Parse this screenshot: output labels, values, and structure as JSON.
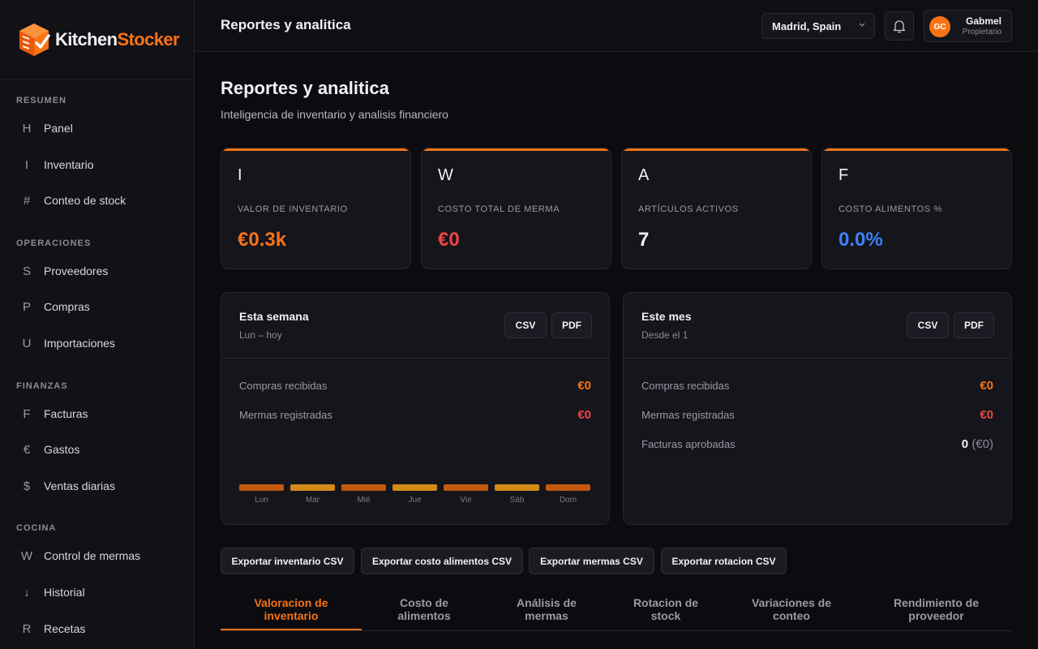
{
  "brand": {
    "name_a": "Kitchen",
    "name_b": "Stocker"
  },
  "sidebar": {
    "sections": [
      {
        "title": "RESUMEN",
        "items": [
          {
            "glyph": "H",
            "label": "Panel"
          },
          {
            "glyph": "I",
            "label": "Inventario"
          },
          {
            "glyph": "#",
            "label": "Conteo de stock"
          }
        ]
      },
      {
        "title": "OPERACIONES",
        "items": [
          {
            "glyph": "S",
            "label": "Proveedores"
          },
          {
            "glyph": "P",
            "label": "Compras"
          },
          {
            "glyph": "U",
            "label": "Importaciones"
          }
        ]
      },
      {
        "title": "FINANZAS",
        "items": [
          {
            "glyph": "F",
            "label": "Facturas"
          },
          {
            "glyph": "€",
            "label": "Gastos"
          },
          {
            "glyph": "$",
            "label": "Ventas diarias"
          }
        ]
      },
      {
        "title": "COCINA",
        "items": [
          {
            "glyph": "W",
            "label": "Control de mermas"
          },
          {
            "glyph": "↓",
            "label": "Historial"
          },
          {
            "glyph": "R",
            "label": "Recetas"
          }
        ]
      }
    ]
  },
  "topbar": {
    "title": "Reportes y analitica",
    "location": "Madrid, Spain",
    "user": {
      "initials": "GC",
      "name": "Gabmel",
      "role": "Propietario"
    }
  },
  "page": {
    "title": "Reportes y analitica",
    "subtitle": "Inteligencia de inventario y analisis financiero"
  },
  "kpis": [
    {
      "icon": "I",
      "label": "VALOR DE INVENTARIO",
      "value": "€0.3k",
      "color": "#f97316"
    },
    {
      "icon": "W",
      "label": "COSTO TOTAL DE MERMA",
      "value": "€0",
      "color": "#ef4444"
    },
    {
      "icon": "A",
      "label": "ARTÍCULOS ACTIVOS",
      "value": "7",
      "color": "#ffffff"
    },
    {
      "icon": "F",
      "label": "COSTO ALIMENTOS %",
      "value": "0.0%",
      "color": "#3b82f6"
    }
  ],
  "week": {
    "title": "Esta semana",
    "subtitle": "Lun – hoy",
    "csv": "CSV",
    "pdf": "PDF",
    "rows": [
      {
        "label": "Compras recibidas",
        "value": "€0"
      },
      {
        "label": "Mermas registradas",
        "value": "€0"
      }
    ],
    "days": [
      "Lun",
      "Mar",
      "Mié",
      "Jue",
      "Vie",
      "Sáb",
      "Dom"
    ]
  },
  "month": {
    "title": "Este mes",
    "subtitle": "Desde el 1",
    "csv": "CSV",
    "pdf": "PDF",
    "rows": [
      {
        "label": "Compras recibidas",
        "value": "€0"
      },
      {
        "label": "Mermas registradas",
        "value": "€0"
      },
      {
        "label": "Facturas aprobadas",
        "value": "0",
        "extra": "(€0)"
      }
    ]
  },
  "exports": [
    "Exportar inventario CSV",
    "Exportar costo alimentos CSV",
    "Exportar mermas CSV",
    "Exportar rotacion CSV"
  ],
  "tabs": [
    {
      "line1": "Valoracion de",
      "line2": "inventario"
    },
    {
      "line1": "Costo de",
      "line2": "alimentos"
    },
    {
      "line1": "Análisis de",
      "line2": "mermas"
    },
    {
      "line1": "Rotacion de",
      "line2": "stock"
    },
    {
      "line1": "Variaciones de",
      "line2": "conteo"
    },
    {
      "line1": "Rendimiento de",
      "line2": "proveedor"
    }
  ]
}
